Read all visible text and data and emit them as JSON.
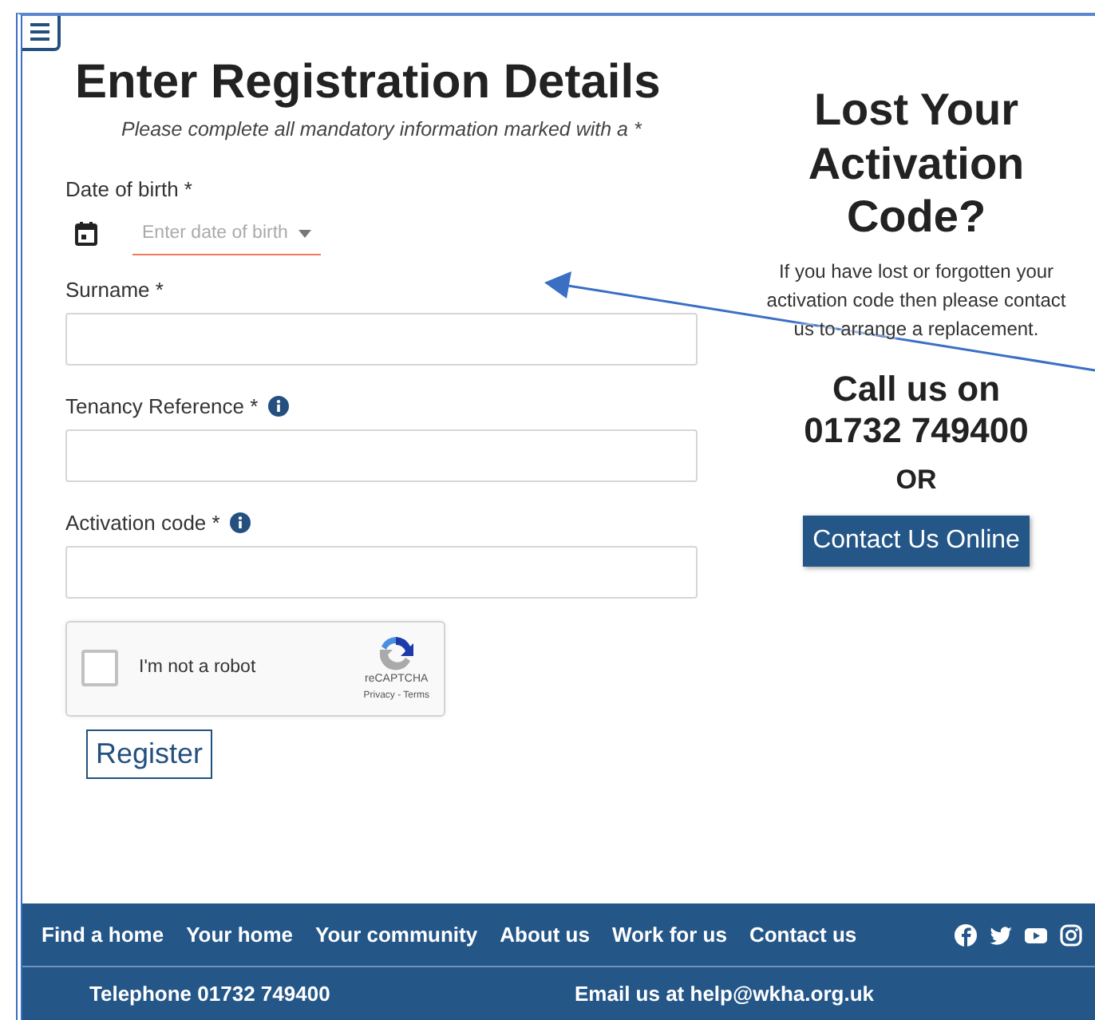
{
  "form": {
    "title": "Enter Registration Details",
    "subtitle": "Please complete all mandatory information marked with a *",
    "fields": [
      {
        "kind": "date",
        "label": "Date of birth *",
        "placeholder": "Enter date of birth",
        "info": false
      },
      {
        "kind": "text",
        "label": "Surname *",
        "info": false
      },
      {
        "kind": "text",
        "label": "Tenancy Reference *",
        "info": true
      },
      {
        "kind": "text",
        "label": "Activation code *",
        "info": true
      }
    ],
    "captcha": {
      "label": "I'm not a robot",
      "checked": false,
      "brand": "reCAPTCHA",
      "links": "Privacy - Terms"
    },
    "submit": "Register"
  },
  "help": {
    "title": "Lost Your Activation Code?",
    "text": "If you have lost or forgotten your activation code then please contact us to arrange a replacement.",
    "call_label": "Call us on",
    "phone": "01732 749400",
    "or": "OR",
    "button": "Contact Us Online"
  },
  "footer": {
    "links": [
      "Find a home",
      "Your home",
      "Your community",
      "About us",
      "Work for us",
      "Contact us"
    ],
    "social": [
      {
        "kind": "facebook"
      },
      {
        "kind": "twitter"
      },
      {
        "kind": "youtube"
      },
      {
        "kind": "instagram"
      }
    ],
    "telephone": "Telephone 01732 749400",
    "email": "Email us at help@wkha.org.uk"
  }
}
